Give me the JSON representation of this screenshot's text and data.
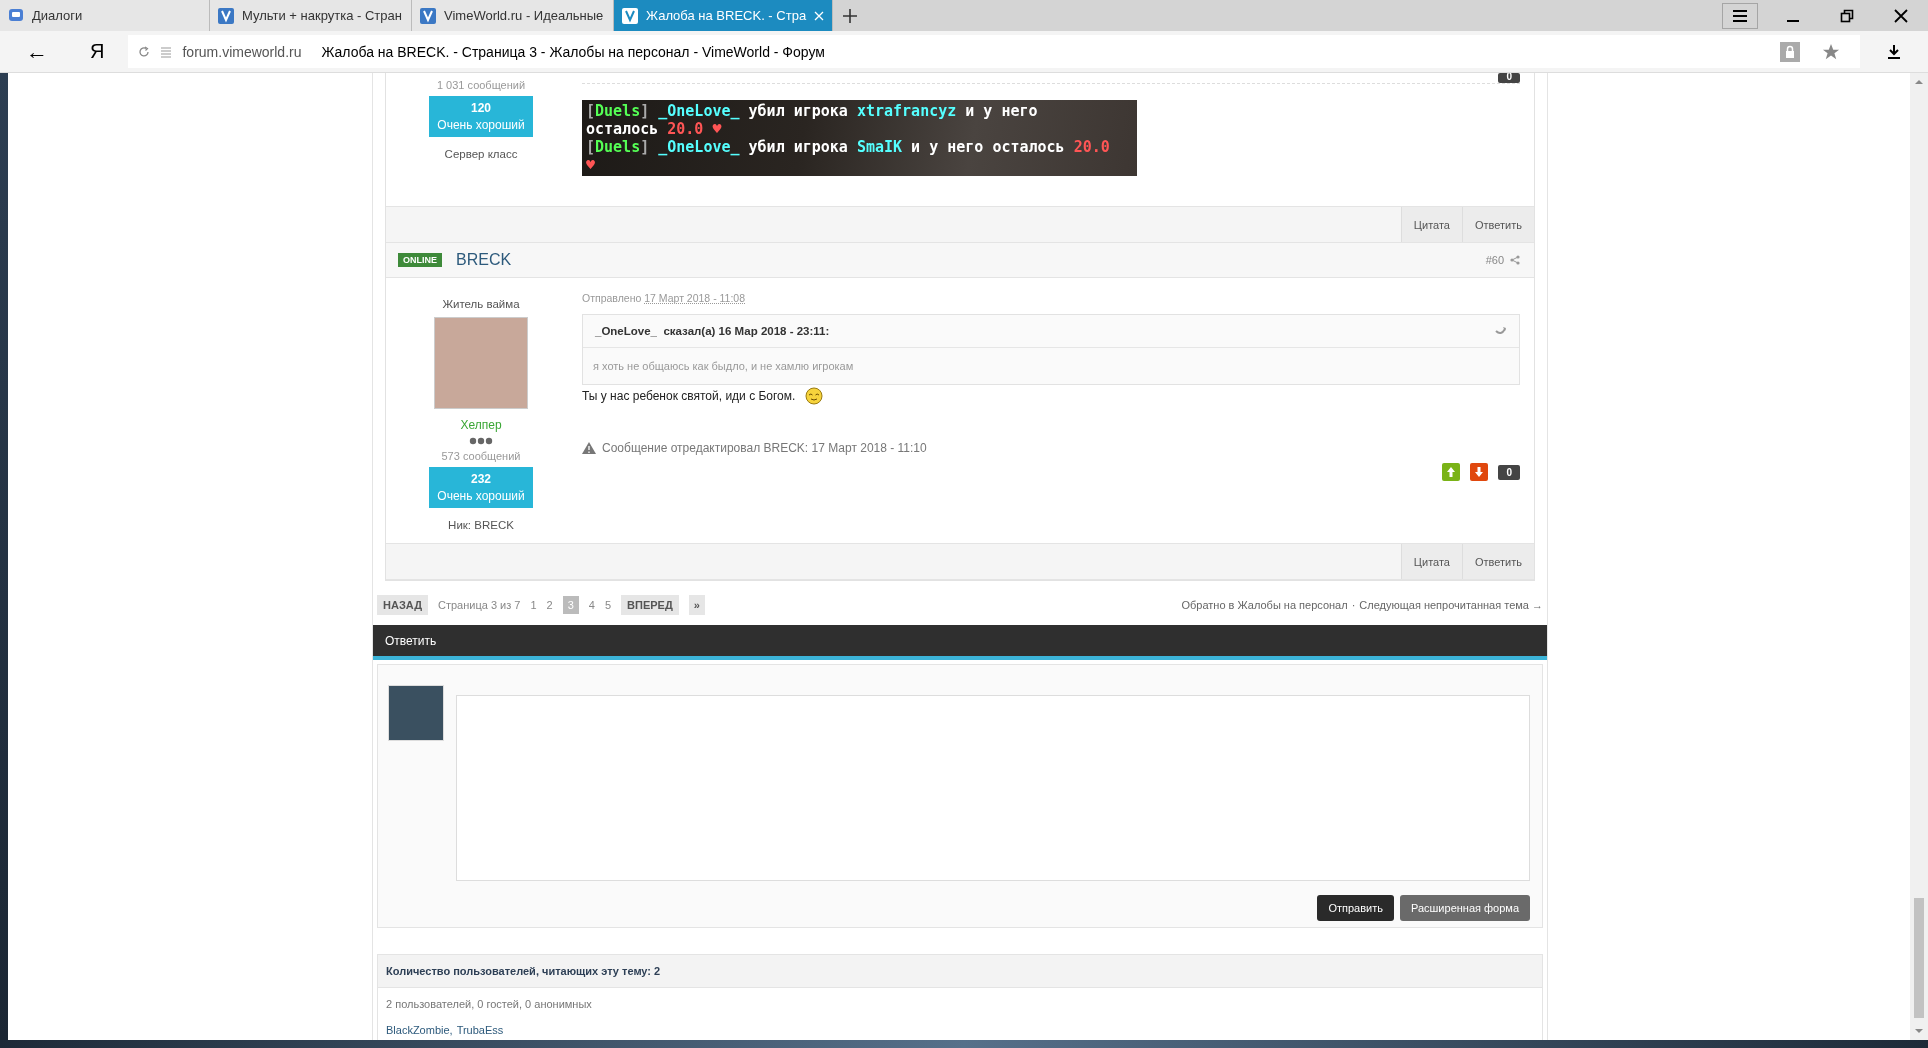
{
  "browser": {
    "tabs": [
      {
        "kind": "chat",
        "title": "Диалоги",
        "selected": false
      },
      {
        "kind": "site",
        "title": "Мульти + накрутка - Стран",
        "selected": false
      },
      {
        "kind": "site",
        "title": "VimeWorld.ru - Идеальные",
        "selected": false
      },
      {
        "kind": "site",
        "title": "Жалоба на BRECK. - Стра",
        "selected": true
      }
    ],
    "back": "←",
    "logo": "Я",
    "domain": "forum.vimeworld.ru",
    "page_title": "Жалоба на BRECK. - Страница 3 - Жалобы на персонал - VimeWorld - Форум"
  },
  "previous_post": {
    "posts_count": "1 031 сообщений",
    "reputation": {
      "value": "120",
      "label": "Очень хороший"
    },
    "note": "Сервер класс",
    "vote_count": "0",
    "chat_lines": [
      [
        {
          "text": "[",
          "color": "#aaaaaa"
        },
        {
          "text": "Duels",
          "color": "#55ff55"
        },
        {
          "text": "] ",
          "color": "#aaaaaa"
        },
        {
          "text": "_OneLove_",
          "color": "#55ffff"
        },
        {
          "text": " убил игрока ",
          "color": "#ffffff"
        },
        {
          "text": "xtrafrancyz",
          "color": "#55ffff"
        },
        {
          "text": " и у него",
          "color": "#ffffff"
        }
      ],
      [
        {
          "text": "осталось ",
          "color": "#ffffff"
        },
        {
          "text": "20.0",
          "color": "#ff5555"
        },
        {
          "text": " ♥",
          "color": "#ff5555"
        }
      ],
      [
        {
          "text": "[",
          "color": "#aaaaaa"
        },
        {
          "text": "Duels",
          "color": "#55ff55"
        },
        {
          "text": "] ",
          "color": "#aaaaaa"
        },
        {
          "text": "_OneLove_",
          "color": "#55ffff"
        },
        {
          "text": " убил игрока ",
          "color": "#ffffff"
        },
        {
          "text": "SmaIK",
          "color": "#55ffff"
        },
        {
          "text": " и у него осталось ",
          "color": "#ffffff"
        },
        {
          "text": "20.0",
          "color": "#ff5555"
        }
      ],
      [
        {
          "text": "♥",
          "color": "#ff5555"
        }
      ]
    ],
    "actions": [
      "Цитата",
      "Ответить"
    ]
  },
  "post": {
    "online_badge": "ONLINE",
    "author": "BRECK",
    "number": "#60",
    "group_title": "Житель вайма",
    "rank": "Хелпер",
    "posts_count": "573 сообщений",
    "reputation": {
      "value": "232",
      "label": "Очень хороший"
    },
    "nick": "Ник: BRECK",
    "posted_label": "Отправлено",
    "posted_date": "17 Март 2018 - 11:08",
    "quote": {
      "header": "_OneLove_  сказал(а) 16 Мар 2018 - 23:11:",
      "text": "я хоть не общаюсь как быдло, и не хамлю игрокам"
    },
    "text": "Ты у нас ребенок святой, иди с Богом.",
    "edit_note": "Сообщение отредактировал BRECK: 17 Март 2018 - 11:10",
    "vote_count": "0",
    "actions": [
      "Цитата",
      "Ответить"
    ]
  },
  "pagination": {
    "prev": "НАЗАД",
    "info": "Страница 3 из 7",
    "pages": [
      {
        "label": "1",
        "selected": false
      },
      {
        "label": "2",
        "selected": false
      },
      {
        "label": "3",
        "selected": true
      },
      {
        "label": "4",
        "selected": false
      },
      {
        "label": "5",
        "selected": false
      }
    ],
    "next": "ВПЕРЕД",
    "last": "»",
    "back_link": "Обратно в Жалобы на персонал",
    "separator": "·",
    "next_unread": "Следующая непрочитанная тема →"
  },
  "reply": {
    "title": "Ответить",
    "buttons": [
      {
        "kind": "primary",
        "label": "Отправить"
      },
      {
        "kind": "secondary",
        "label": "Расширенная форма"
      }
    ]
  },
  "readers": {
    "title": "Количество пользователей, читающих эту тему: 2",
    "summary": "2 пользователей, 0 гостей, 0 анонимных",
    "users": [
      "BlackZombie",
      "TrubaEss"
    ],
    "users_separator": ","
  }
}
